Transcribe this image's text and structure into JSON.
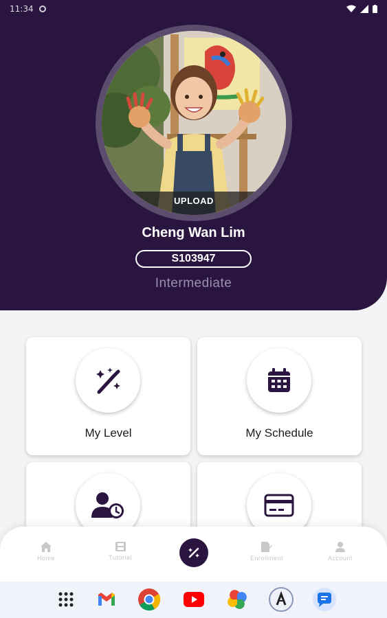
{
  "status_bar": {
    "time": "11:34"
  },
  "profile": {
    "upload_label": "UPLOAD",
    "name": "Cheng Wan Lim",
    "student_id": "S103947",
    "level": "Intermediate"
  },
  "menu": {
    "cards": [
      {
        "label": "My Level",
        "icon": "magic-wand-icon"
      },
      {
        "label": "My Schedule",
        "icon": "calendar-icon"
      },
      {
        "label": "",
        "icon": "user-clock-icon"
      },
      {
        "label": "",
        "icon": "credit-card-icon"
      }
    ]
  },
  "bottom_nav": {
    "items": [
      {
        "label": "Home",
        "icon": "home-icon"
      },
      {
        "label": "Tutorial",
        "icon": "film-icon"
      },
      {
        "label": "",
        "icon": "magic-wand-icon"
      },
      {
        "label": "Enrollment",
        "icon": "edit-document-icon"
      },
      {
        "label": "Account",
        "icon": "person-icon"
      }
    ]
  },
  "dock": [
    "apps-grid-icon",
    "gmail-icon",
    "chrome-icon",
    "youtube-icon",
    "photos-icon",
    "app-icon",
    "messages-icon"
  ],
  "colors": {
    "header": "#2a1540",
    "accent": "#2a1540",
    "level_text": "#9a8fb0"
  }
}
